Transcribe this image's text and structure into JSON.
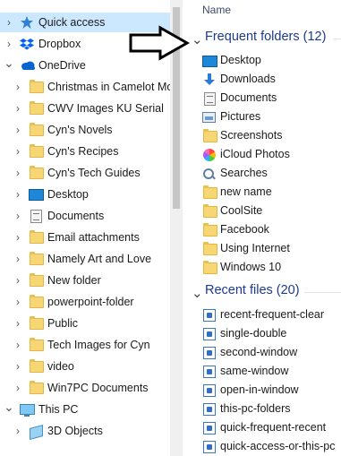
{
  "nav": {
    "items": [
      {
        "label": "Quick access",
        "icon": "star-icon",
        "indent": 0,
        "expand": "collapsed",
        "selected": true
      },
      {
        "label": "Dropbox",
        "icon": "dropbox-icon",
        "indent": 0,
        "expand": "collapsed"
      },
      {
        "label": "OneDrive",
        "icon": "onedrive-icon",
        "indent": 0,
        "expand": "expanded"
      },
      {
        "label": "Christmas in Camelot Mo",
        "icon": "folder-icon",
        "indent": 1,
        "expand": "collapsed"
      },
      {
        "label": "CWV Images KU Serial",
        "icon": "folder-icon",
        "indent": 1,
        "expand": "collapsed"
      },
      {
        "label": "Cyn's Novels",
        "icon": "folder-icon",
        "indent": 1,
        "expand": "collapsed"
      },
      {
        "label": "Cyn's Recipes",
        "icon": "folder-icon",
        "indent": 1,
        "expand": "collapsed"
      },
      {
        "label": "Cyn's Tech Guides",
        "icon": "folder-icon",
        "indent": 1,
        "expand": "collapsed"
      },
      {
        "label": "Desktop",
        "icon": "desktop-icon",
        "indent": 1,
        "expand": "collapsed"
      },
      {
        "label": "Documents",
        "icon": "document-icon",
        "indent": 1,
        "expand": "collapsed"
      },
      {
        "label": "Email attachments",
        "icon": "folder-icon",
        "indent": 1,
        "expand": "collapsed"
      },
      {
        "label": "Namely Art and Love",
        "icon": "folder-icon",
        "indent": 1,
        "expand": "collapsed"
      },
      {
        "label": "New folder",
        "icon": "folder-icon",
        "indent": 1,
        "expand": "collapsed"
      },
      {
        "label": "powerpoint-folder",
        "icon": "folder-icon",
        "indent": 1,
        "expand": "collapsed"
      },
      {
        "label": "Public",
        "icon": "folder-icon",
        "indent": 1,
        "expand": "collapsed"
      },
      {
        "label": "Tech Images for Cyn",
        "icon": "folder-icon",
        "indent": 1,
        "expand": "collapsed"
      },
      {
        "label": "video",
        "icon": "folder-icon",
        "indent": 1,
        "expand": "collapsed"
      },
      {
        "label": "Win7PC Documents",
        "icon": "folder-icon",
        "indent": 1,
        "expand": "collapsed"
      },
      {
        "label": "This PC",
        "icon": "this-pc-icon",
        "indent": 0,
        "expand": "expanded"
      },
      {
        "label": "3D Objects",
        "icon": "3d-objects-icon",
        "indent": 1,
        "expand": "collapsed"
      }
    ]
  },
  "main": {
    "column_header": "Name",
    "frequent": {
      "title": "Frequent folders (12)",
      "items": [
        {
          "label": "Desktop",
          "icon": "desktop-icon"
        },
        {
          "label": "Downloads",
          "icon": "downloads-icon"
        },
        {
          "label": "Documents",
          "icon": "document-icon"
        },
        {
          "label": "Pictures",
          "icon": "pictures-icon"
        },
        {
          "label": "Screenshots",
          "icon": "folder-icon"
        },
        {
          "label": "iCloud Photos",
          "icon": "icloud-photos-icon"
        },
        {
          "label": "Searches",
          "icon": "search-icon"
        },
        {
          "label": "new name",
          "icon": "folder-icon"
        },
        {
          "label": "CoolSite",
          "icon": "folder-icon"
        },
        {
          "label": "Facebook",
          "icon": "folder-icon"
        },
        {
          "label": "Using Internet",
          "icon": "folder-icon"
        },
        {
          "label": "Windows 10",
          "icon": "folder-icon"
        }
      ]
    },
    "recent": {
      "title": "Recent files (20)",
      "items": [
        {
          "label": "recent-frequent-clear",
          "icon": "image-file-icon"
        },
        {
          "label": "single-double",
          "icon": "image-file-icon"
        },
        {
          "label": "second-window",
          "icon": "image-file-icon"
        },
        {
          "label": "same-window",
          "icon": "image-file-icon"
        },
        {
          "label": "open-in-window",
          "icon": "image-file-icon"
        },
        {
          "label": "this-pc-folders",
          "icon": "image-file-icon"
        },
        {
          "label": "quick-frequent-recent",
          "icon": "image-file-icon"
        },
        {
          "label": "quick-access-or-this-pc",
          "icon": "image-file-icon"
        }
      ]
    }
  },
  "colors": {
    "selection": "#cce8ff",
    "group_title": "#1e3a8a",
    "onedrive": "#0a64d0",
    "dropbox": "#0061fe"
  }
}
